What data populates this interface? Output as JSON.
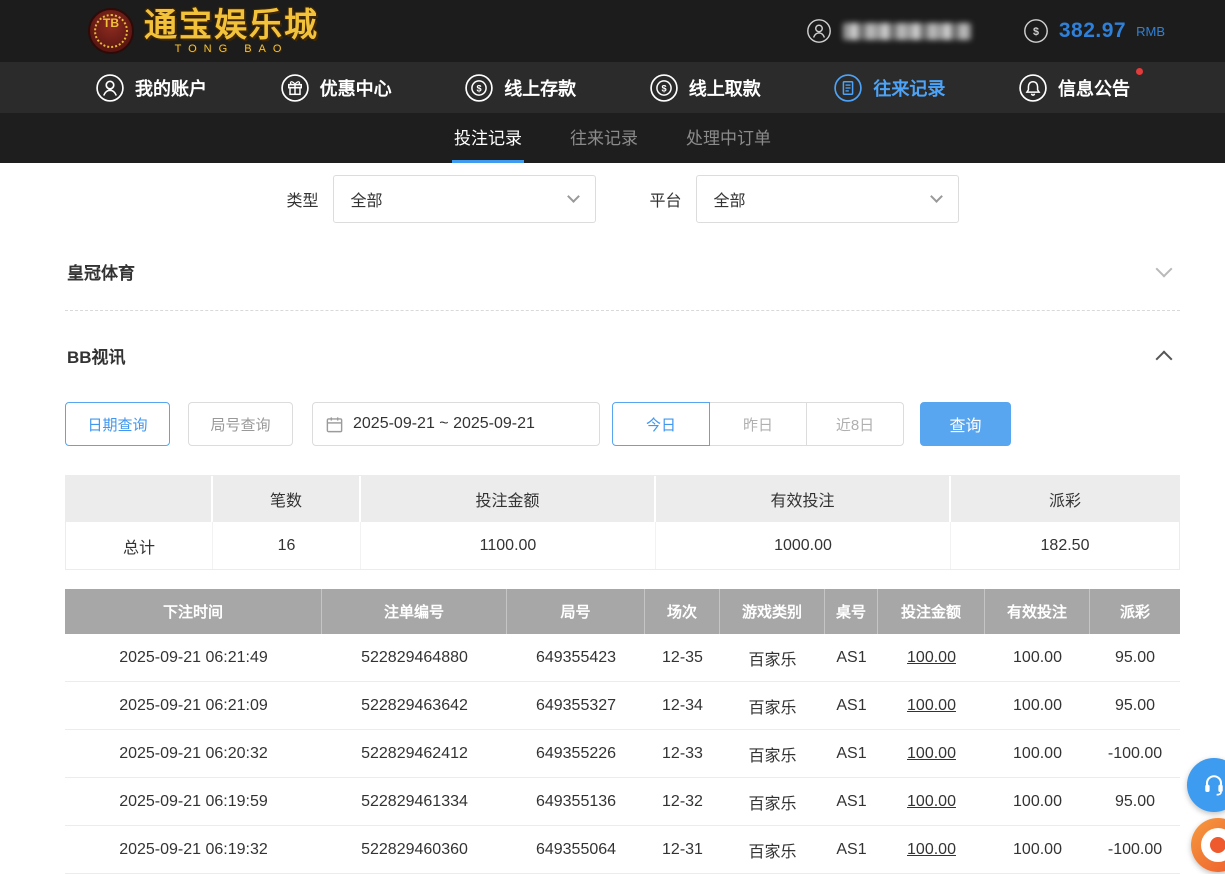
{
  "header": {
    "logo": {
      "badge": "TB",
      "title": "通宝娱乐城",
      "subtitle": "TONG BAO"
    },
    "balance": {
      "amount": "382.97",
      "currency": "RMB"
    }
  },
  "nav": {
    "items": [
      {
        "label": "我的账户",
        "icon": "account-icon"
      },
      {
        "label": "优惠中心",
        "icon": "promo-icon"
      },
      {
        "label": "线上存款",
        "icon": "deposit-icon"
      },
      {
        "label": "线上取款",
        "icon": "withdraw-icon"
      },
      {
        "label": "往来记录",
        "icon": "records-icon"
      },
      {
        "label": "信息公告",
        "icon": "announcement-icon"
      }
    ],
    "active_index": 4
  },
  "tabs": {
    "items": [
      {
        "label": "投注记录"
      },
      {
        "label": "往来记录"
      },
      {
        "label": "处理中订单"
      }
    ],
    "active_index": 0
  },
  "filters": {
    "type": {
      "label": "类型",
      "value": "全部"
    },
    "platform": {
      "label": "平台",
      "value": "全部"
    }
  },
  "sections": {
    "crown": {
      "title": "皇冠体育",
      "state": "collapsed"
    },
    "bb": {
      "title": "BB视讯",
      "state": "expanded"
    }
  },
  "query": {
    "date_query": "日期查询",
    "round_query": "局号查询",
    "date_range": "2025-09-21 ~ 2025-09-21",
    "quick": {
      "today": "今日",
      "yesterday": "昨日",
      "last8": "近8日"
    },
    "submit": "查询"
  },
  "summary": {
    "headers": {
      "count": "笔数",
      "bet_amount": "投注金额",
      "valid_bet": "有效投注",
      "payout": "派彩"
    },
    "total_label": "总计",
    "total": {
      "count": "16",
      "bet_amount": "1100.00",
      "valid_bet": "1000.00",
      "payout": "182.50"
    }
  },
  "bet_table": {
    "headers": [
      "下注时间",
      "注单编号",
      "局号",
      "场次",
      "游戏类别",
      "桌号",
      "投注金额",
      "有效投注",
      "派彩"
    ],
    "rows": [
      {
        "time": "2025-09-21 06:21:49",
        "bet_no": "522829464880",
        "round_no": "649355423",
        "session": "12-35",
        "game": "百家乐",
        "table_no": "AS1",
        "bet_amount": "100.00",
        "valid_bet": "100.00",
        "payout": "95.00"
      },
      {
        "time": "2025-09-21 06:21:09",
        "bet_no": "522829463642",
        "round_no": "649355327",
        "session": "12-34",
        "game": "百家乐",
        "table_no": "AS1",
        "bet_amount": "100.00",
        "valid_bet": "100.00",
        "payout": "95.00"
      },
      {
        "time": "2025-09-21 06:20:32",
        "bet_no": "522829462412",
        "round_no": "649355226",
        "session": "12-33",
        "game": "百家乐",
        "table_no": "AS1",
        "bet_amount": "100.00",
        "valid_bet": "100.00",
        "payout": "-100.00"
      },
      {
        "time": "2025-09-21 06:19:59",
        "bet_no": "522829461334",
        "round_no": "649355136",
        "session": "12-32",
        "game": "百家乐",
        "table_no": "AS1",
        "bet_amount": "100.00",
        "valid_bet": "100.00",
        "payout": "95.00"
      },
      {
        "time": "2025-09-21 06:19:32",
        "bet_no": "522829460360",
        "round_no": "649355064",
        "session": "12-31",
        "game": "百家乐",
        "table_no": "AS1",
        "bet_amount": "100.00",
        "valid_bet": "100.00",
        "payout": "-100.00"
      }
    ]
  },
  "floats": {
    "customer_service_icon": "headset-icon",
    "promo_icon": "promo-float-icon"
  },
  "colors": {
    "accent_blue": "#3f97ef",
    "link_blue": "#6db0f5",
    "negative_red": "#f03e3e",
    "gold": "#f2c23c"
  }
}
